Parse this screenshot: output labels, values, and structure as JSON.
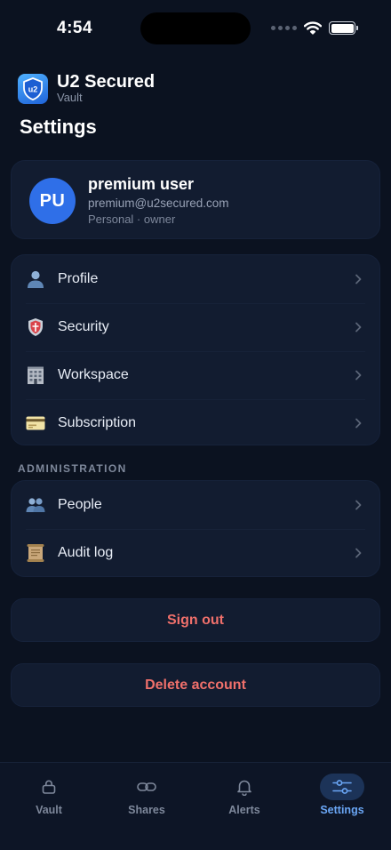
{
  "status_bar": {
    "time": "4:54"
  },
  "app": {
    "name": "U2 Secured",
    "subtitle": "Vault",
    "logo_text": "u2"
  },
  "page": {
    "title": "Settings"
  },
  "profile": {
    "initials": "PU",
    "name": "premium user",
    "email": "premium@u2secured.com",
    "role": "Personal · owner",
    "avatar_color": "#2f6fe8"
  },
  "account_items": [
    {
      "label": "Profile",
      "icon": "person-icon"
    },
    {
      "label": "Security",
      "icon": "shield-icon"
    },
    {
      "label": "Workspace",
      "icon": "office-building-icon"
    },
    {
      "label": "Subscription",
      "icon": "credit-card-icon"
    }
  ],
  "admin": {
    "section_label": "ADMINISTRATION",
    "items": [
      {
        "label": "People",
        "icon": "people-icon"
      },
      {
        "label": "Audit log",
        "icon": "scroll-icon"
      }
    ]
  },
  "actions": {
    "sign_out": "Sign out",
    "delete_account": "Delete account",
    "danger_color": "#f0706b"
  },
  "tabs": [
    {
      "label": "Vault",
      "icon": "lock-icon",
      "active": false
    },
    {
      "label": "Shares",
      "icon": "link-icon",
      "active": false
    },
    {
      "label": "Alerts",
      "icon": "bell-icon",
      "active": false
    },
    {
      "label": "Settings",
      "icon": "sliders-icon",
      "active": true
    }
  ],
  "colors": {
    "background": "#0b1220",
    "card": "#121c30",
    "accent": "#6aa6f5",
    "active_tab_bg": "#1c3358"
  }
}
